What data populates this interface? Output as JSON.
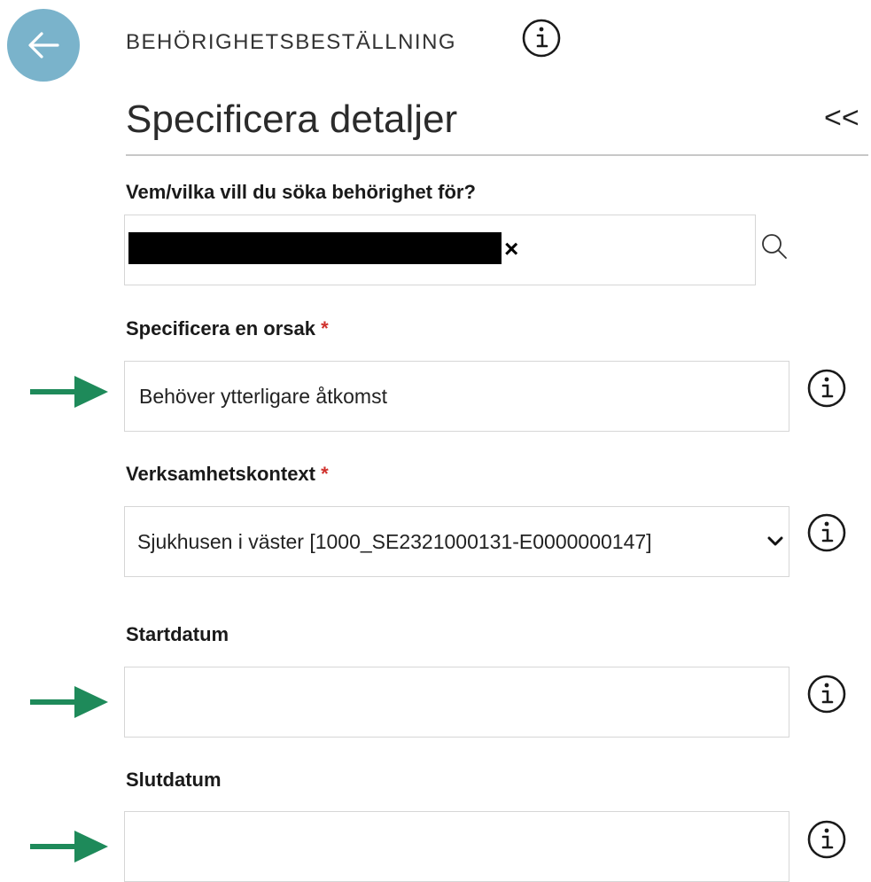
{
  "header": {
    "app_title": "BEHÖRIGHETSBESTÄLLNING",
    "page_title": "Specificera detaljer",
    "collapse_label": "<<"
  },
  "fields": {
    "who": {
      "label": "Vem/vilka vill du söka behörighet för?",
      "clear_label": "×"
    },
    "reason": {
      "label": "Specificera en orsak",
      "required_mark": "*",
      "value": "Behöver ytterligare åtkomst"
    },
    "context": {
      "label": "Verksamhetskontext",
      "required_mark": "*",
      "selected": "Sjukhusen i väster [1000_SE2321000131-E0000000147]"
    },
    "start": {
      "label": "Startdatum",
      "value": ""
    },
    "end": {
      "label": "Slutdatum",
      "value": ""
    }
  },
  "colors": {
    "back_button": "#7ab3cb",
    "required": "#d0312d",
    "arrow": "#1e8a5a"
  },
  "icons": {
    "back": "arrow-left-icon",
    "info": "info-icon",
    "search": "search-icon",
    "clear": "close-icon",
    "dropdown": "chevron-down-icon",
    "annotation": "arrow-right-icon"
  }
}
